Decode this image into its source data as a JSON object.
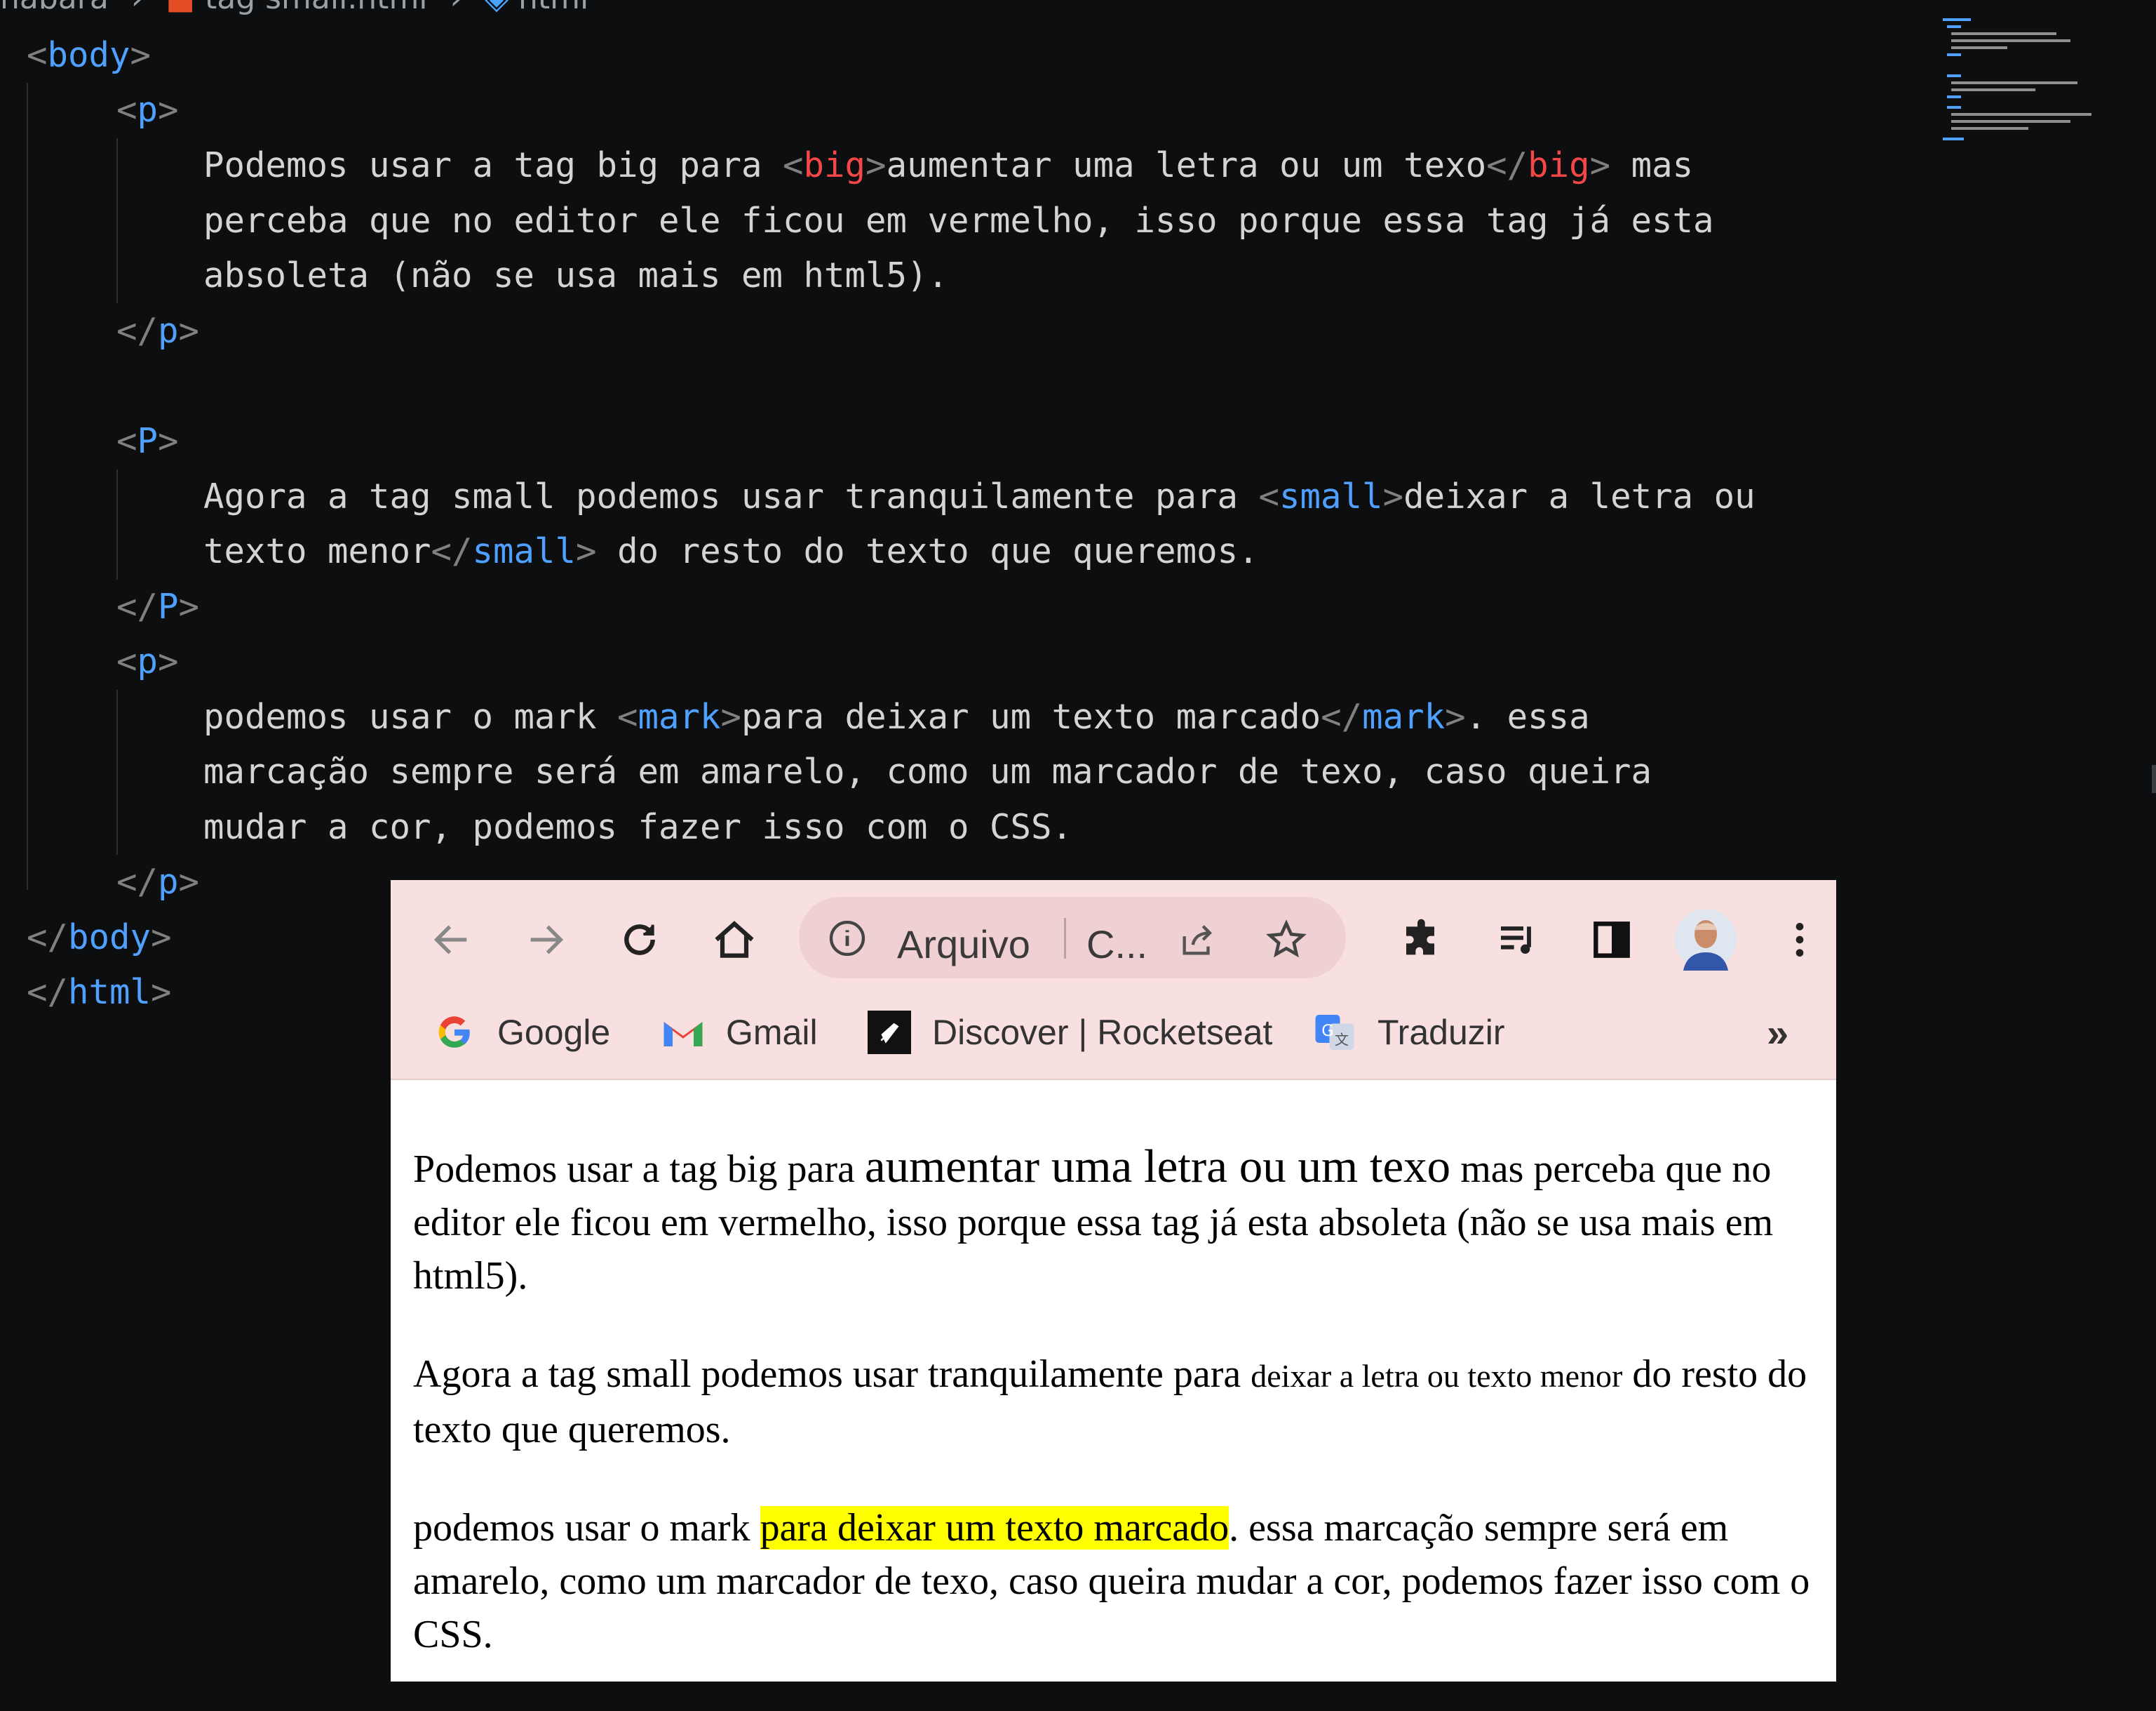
{
  "editor": {
    "breadcrumb": [
      "nabara",
      "tag small.html",
      "html"
    ],
    "lines": {
      "body_open": "body",
      "p1_open": "p",
      "p1_text1_a": "Podemos usar a tag big para ",
      "p1_tag_big": "big",
      "p1_text1_b": "aumentar uma letra ou um texo",
      "p1_text1_c": " mas",
      "p1_text2": "perceba que no editor ele ficou em vermelho, isso porque essa tag já esta",
      "p1_text3": "absoleta (não se usa mais em html5).",
      "p1_close": "p",
      "p2_open": "P",
      "p2_text1_a": "Agora a tag small podemos usar tranquilamente para ",
      "p2_tag_small": "small",
      "p2_text1_b": "deixar a letra ou",
      "p2_text2_a": "texto menor",
      "p2_text2_b": " do resto do texto que queremos.",
      "p2_close": "P",
      "p3_open": "p",
      "p3_text1_a": "podemos usar o mark ",
      "p3_tag_mark": "mark",
      "p3_text1_b": "para deixar um texto marcado",
      "p3_text1_c": ". essa",
      "p3_text2": "marcação sempre será em amarelo, como um marcador de texo, caso queira",
      "p3_text3": "mudar a cor, podemos fazer isso com o CSS.",
      "p3_close": "p",
      "body_close": "body",
      "html_close": "html"
    }
  },
  "browser": {
    "omnibox": {
      "security_label": "Arquivo",
      "url": "C..."
    },
    "bookmarks": [
      {
        "label": "Google",
        "icon": "google-icon"
      },
      {
        "label": "Gmail",
        "icon": "gmail-icon"
      },
      {
        "label": "Discover | Rocketseat",
        "icon": "rocketseat-icon"
      },
      {
        "label": "Traduzir",
        "icon": "translate-icon"
      }
    ],
    "more_bookmarks": "»",
    "page": {
      "p1_a": "Podemos usar a tag big para ",
      "p1_big": "aumentar uma letra ou um texo",
      "p1_b": " mas perceba que no editor ele ficou em vermelho, isso porque essa tag já esta absoleta (não se usa mais em html5).",
      "p2_a": "Agora a tag small podemos usar tranquilamente para ",
      "p2_small": "deixar a letra ou texto menor",
      "p2_b": " do resto do texto que queremos.",
      "p3_a": "podemos usar o mark ",
      "p3_mark": "para deixar um texto marcado",
      "p3_b": ". essa marcação sempre será em amarelo, como um marcador de texo, caso queira mudar a cor, podemos fazer isso com o CSS."
    }
  },
  "colors": {
    "editor_bg": "#0d0e0f",
    "tag": "#4fa0ff",
    "deprecated_tag": "#f44747",
    "mark": "#ffff00",
    "chrome_bg": "#f8dfe0"
  }
}
